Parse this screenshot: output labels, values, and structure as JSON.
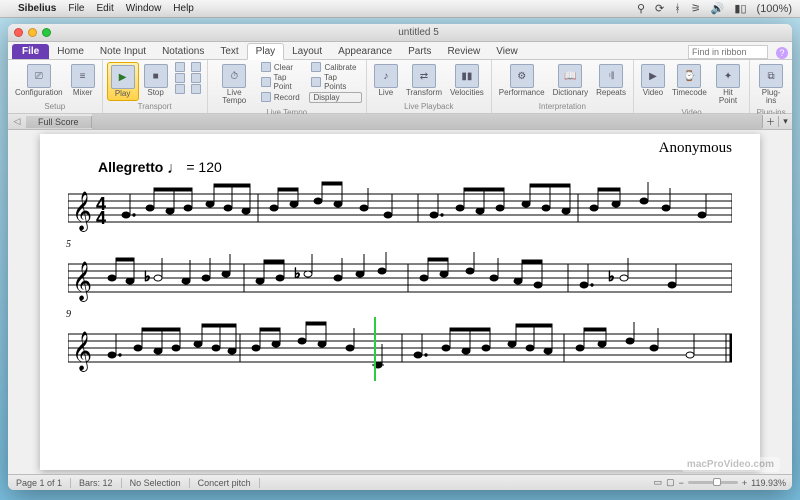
{
  "mac_menu": {
    "app": "Sibelius",
    "items": [
      "File",
      "Edit",
      "Window",
      "Help"
    ],
    "battery": "(100%)"
  },
  "window": {
    "title": "untitled 5"
  },
  "ribbon": {
    "file_label": "File",
    "tabs": [
      "Home",
      "Note Input",
      "Notations",
      "Text",
      "Play",
      "Layout",
      "Appearance",
      "Parts",
      "Review",
      "View"
    ],
    "active_tab": "Play",
    "search_placeholder": "Find in ribbon",
    "groups": {
      "setup": {
        "label": "Setup",
        "config": "Configuration",
        "mixer": "Mixer"
      },
      "transport": {
        "label": "Transport",
        "play": "Play",
        "stop": "Stop"
      },
      "live_tempo": {
        "label": "Live Tempo",
        "live_tempo": "Live\nTempo",
        "clear": "Clear",
        "tap_point": "Tap Point",
        "record": "Record",
        "calibrate": "Calibrate",
        "tap_points": "Tap Points",
        "display": "Display"
      },
      "live_playback": {
        "label": "Live Playback",
        "live": "Live",
        "transform": "Transform",
        "velocities": "Velocities"
      },
      "interpretation": {
        "label": "Interpretation",
        "performance": "Performance",
        "dictionary": "Dictionary",
        "repeats": "Repeats"
      },
      "video": {
        "label": "Video",
        "video": "Video",
        "timecode": "Timecode",
        "hitpoint": "Hit\nPoint"
      },
      "plugins": {
        "label": "Plug-ins",
        "plugins": "Plug-ins"
      }
    }
  },
  "subbar": {
    "full_score": "Full Score"
  },
  "score": {
    "composer": "Anonymous",
    "tempo_word": "Allegretto",
    "tempo_value": "= 120",
    "time_sig": "4/4",
    "systems": [
      {
        "bar_number": "",
        "playback_pos": null
      },
      {
        "bar_number": "5",
        "playback_pos": null
      },
      {
        "bar_number": "9",
        "playback_pos": 0.46
      }
    ]
  },
  "status": {
    "page": "Page 1 of 1",
    "bars": "Bars: 12",
    "selection": "No Selection",
    "pitch": "Concert pitch",
    "zoom": "119.93%"
  },
  "watermark": "macProVideo.com"
}
